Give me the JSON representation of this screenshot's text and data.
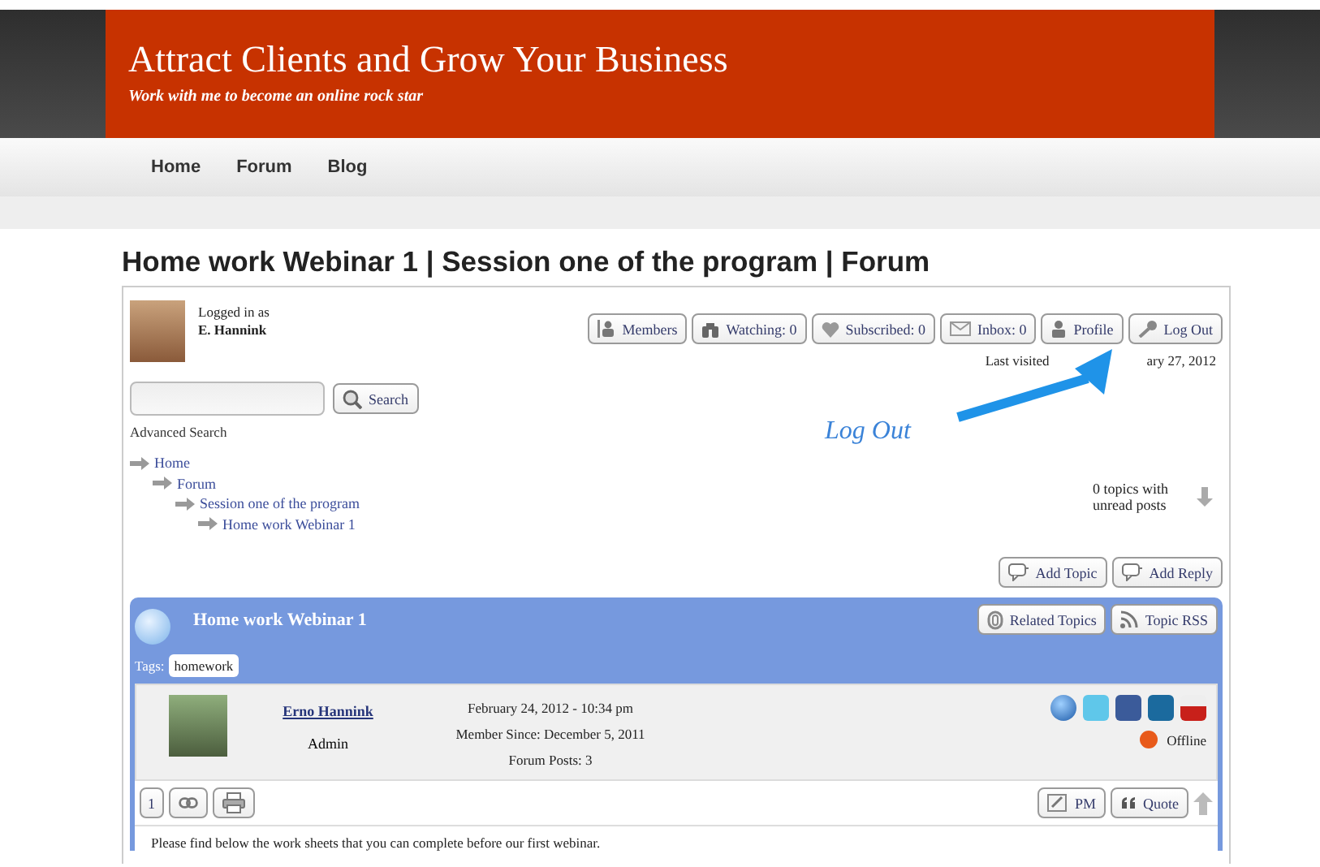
{
  "site": {
    "title": "Attract Clients and Grow Your Business",
    "tagline": "Work with me to become an online rock star"
  },
  "nav": [
    {
      "label": "Home"
    },
    {
      "label": "Forum"
    },
    {
      "label": "Blog"
    }
  ],
  "page_title": "Home work Webinar 1 | Session one of the program | Forum",
  "user": {
    "logged_in_label": "Logged in as",
    "name": "E. Hannink"
  },
  "user_buttons": [
    {
      "label": "Members"
    },
    {
      "label": "Watching: 0"
    },
    {
      "label": "Subscribed: 0"
    },
    {
      "label": "Inbox: 0"
    },
    {
      "label": "Profile"
    },
    {
      "label": "Log Out"
    }
  ],
  "last_visited": [
    "Last visited",
    "ary 27, 2012"
  ],
  "search": {
    "button": "Search",
    "advanced": "Advanced Search"
  },
  "breadcrumbs": [
    {
      "label": "Home",
      "children": [
        {
          "label": "Forum",
          "children": [
            {
              "label": "Session one of the program",
              "children": [
                {
                  "label": "Home work Webinar 1"
                }
              ]
            }
          ]
        }
      ]
    }
  ],
  "annotation": {
    "label": "Log Out"
  },
  "unread": "0 topics with unread posts",
  "topic_actions": [
    "Add Topic",
    "Add Reply"
  ],
  "topic": {
    "title": "Home work Webinar 1",
    "buttons": [
      "Related Topics",
      "Topic RSS"
    ],
    "tags_label": "Tags:",
    "tags": [
      "homework"
    ]
  },
  "post": {
    "author": "Erno Hannink",
    "role": "Admin",
    "date": "February 24, 2012 - 10:34 pm",
    "member_since": "Member Since: December 5, 2011",
    "posts": "Forum Posts: 3",
    "online": false,
    "status": "Offline",
    "number": "1",
    "buttons": [
      "PM",
      "Quote"
    ],
    "body": "Please find below the work sheets that you can complete before our first webinar."
  }
}
